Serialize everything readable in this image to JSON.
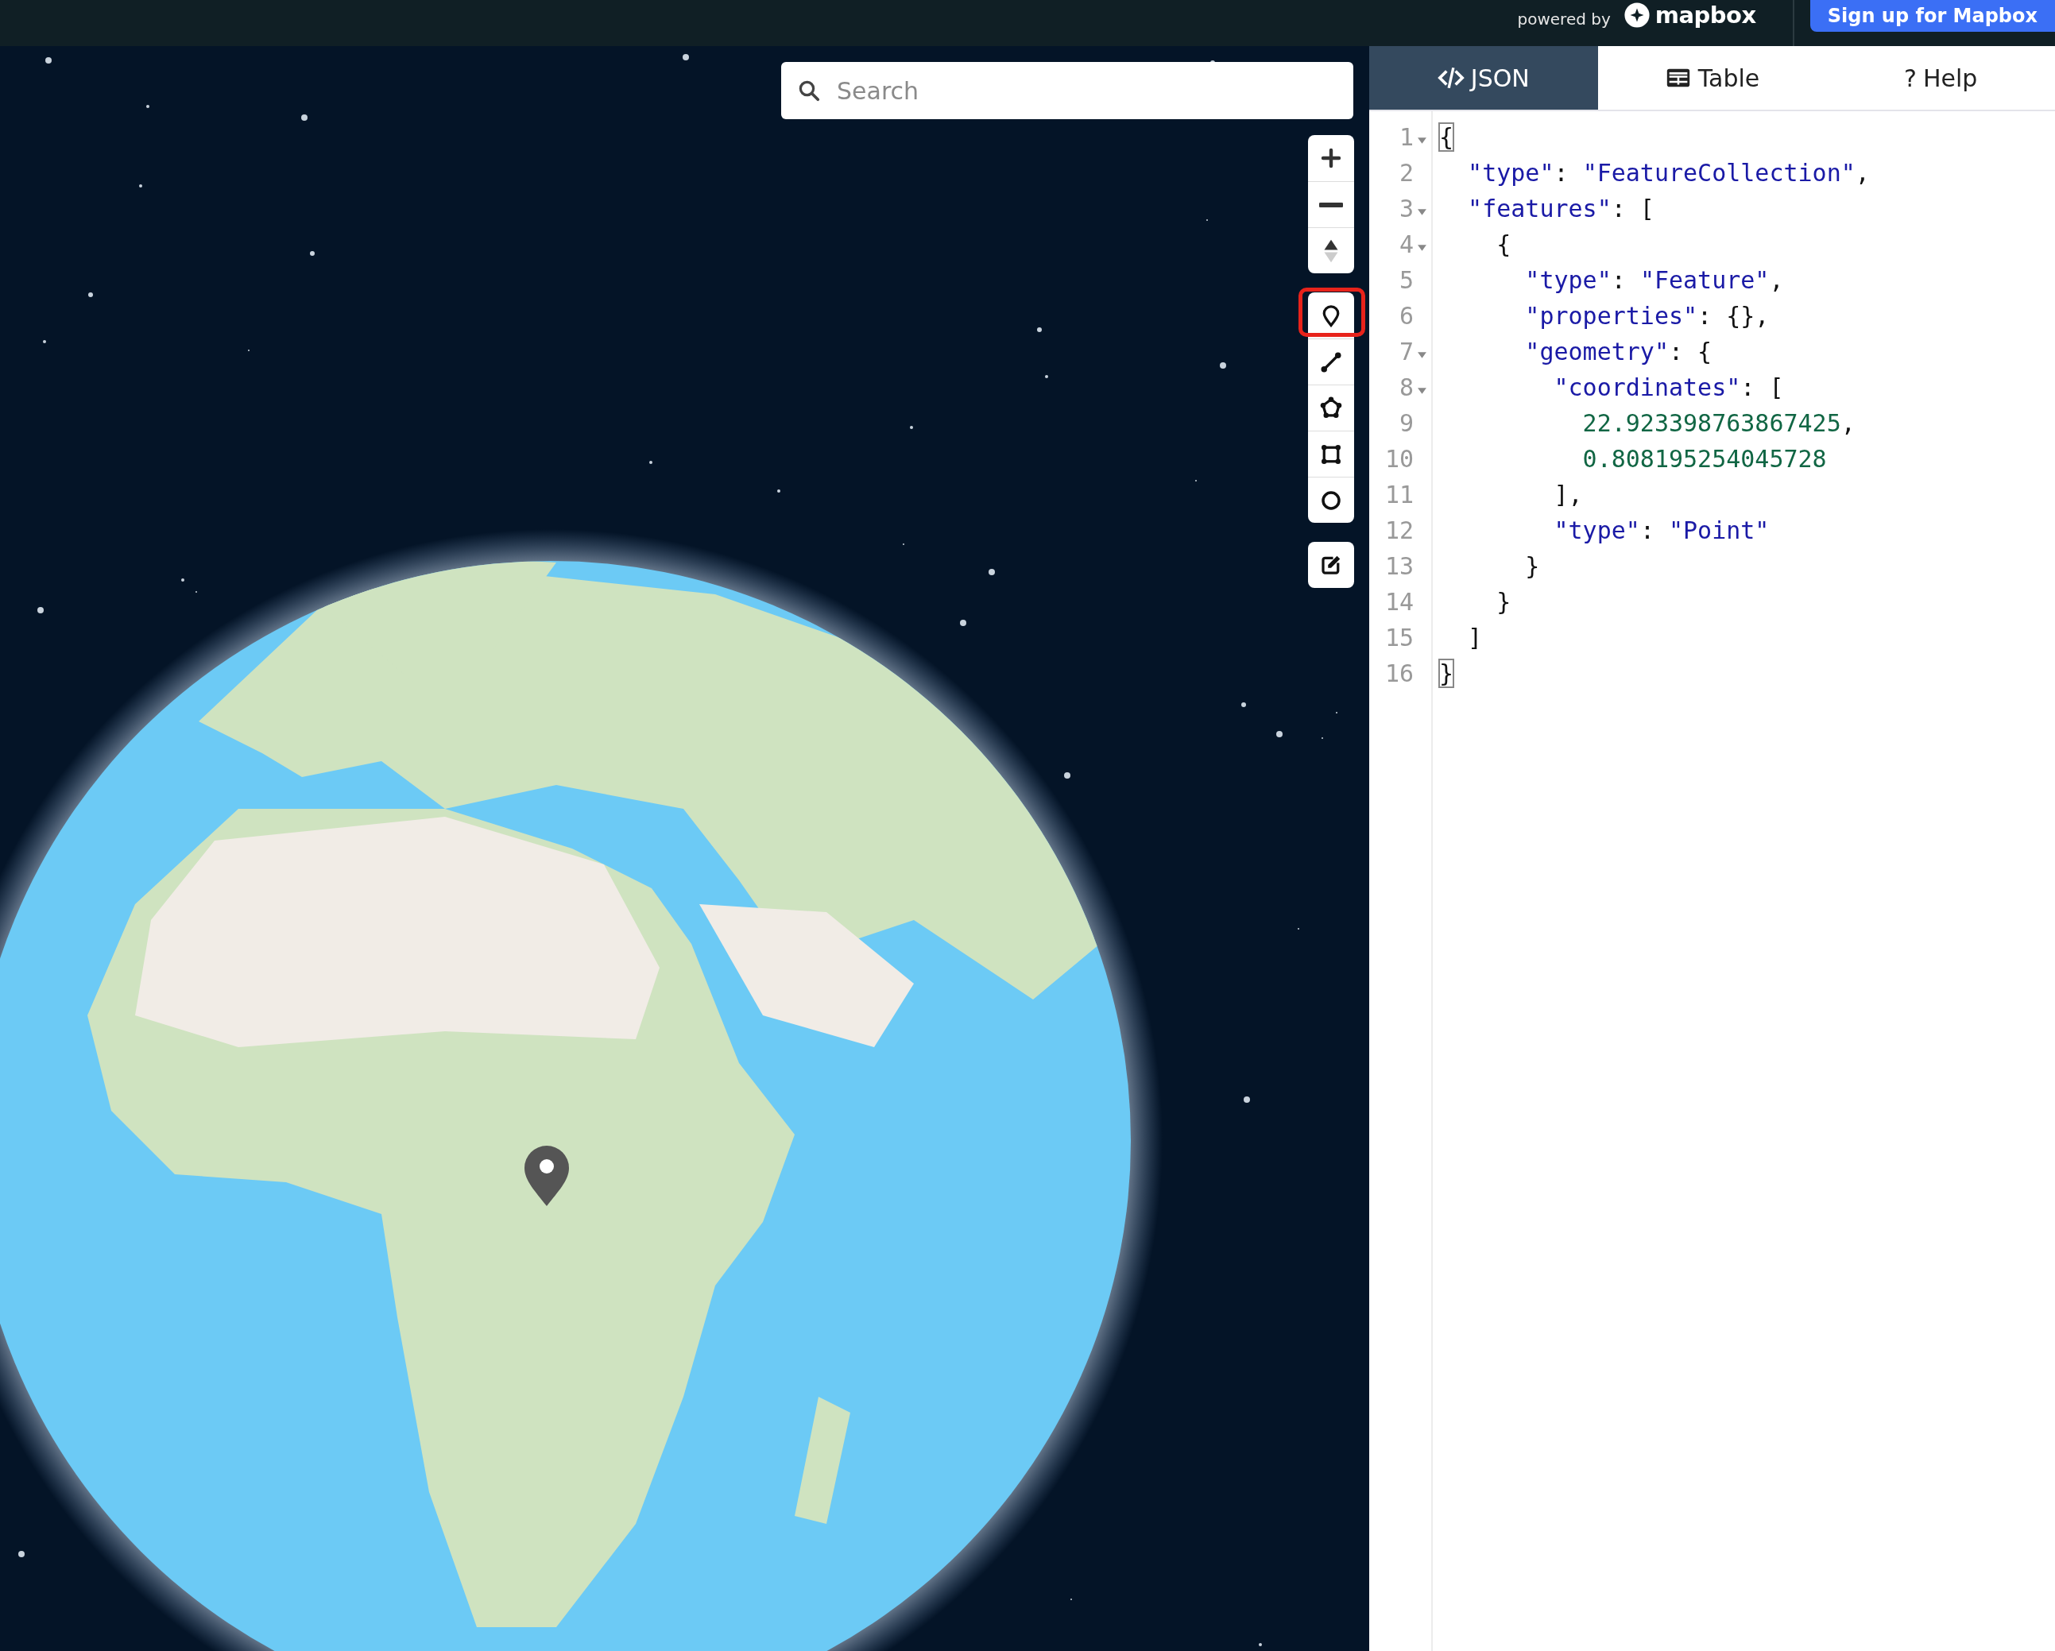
{
  "top_bar": {
    "powered_by": "powered by",
    "logo_text": "mapbox",
    "signup_button": "Sign up for Mapbox"
  },
  "map": {
    "search": {
      "placeholder": "Search"
    },
    "nav_controls": [
      {
        "kind": "zoom-in"
      },
      {
        "kind": "zoom-out"
      },
      {
        "kind": "compass"
      }
    ],
    "draw_tools": [
      {
        "kind": "point",
        "highlighted": true
      },
      {
        "kind": "line",
        "highlighted": false
      },
      {
        "kind": "polygon",
        "highlighted": false
      },
      {
        "kind": "rectangle",
        "highlighted": false
      },
      {
        "kind": "circle",
        "highlighted": false
      }
    ],
    "edit_tool": {
      "kind": "edit"
    }
  },
  "side_panel": {
    "tabs": [
      {
        "kind": "json",
        "label": "JSON",
        "selected": true
      },
      {
        "kind": "table",
        "label": "Table",
        "selected": false
      },
      {
        "kind": "help",
        "glyph": "?",
        "label": "Help",
        "selected": false
      }
    ],
    "code_lines": [
      {
        "number": "1",
        "foldable": true,
        "tokens": [
          {
            "kind": "punct",
            "text": "{",
            "matched": true
          }
        ]
      },
      {
        "number": "2",
        "foldable": false,
        "tokens": [
          {
            "kind": "key",
            "text": "  \"type\""
          },
          {
            "kind": "punct",
            "text": ": "
          },
          {
            "kind": "string",
            "text": "\"FeatureCollection\""
          },
          {
            "kind": "punct",
            "text": ","
          }
        ]
      },
      {
        "number": "3",
        "foldable": true,
        "tokens": [
          {
            "kind": "key",
            "text": "  \"features\""
          },
          {
            "kind": "punct",
            "text": ": ["
          }
        ]
      },
      {
        "number": "4",
        "foldable": true,
        "tokens": [
          {
            "kind": "punct",
            "text": "    {"
          }
        ]
      },
      {
        "number": "5",
        "foldable": false,
        "tokens": [
          {
            "kind": "key",
            "text": "      \"type\""
          },
          {
            "kind": "punct",
            "text": ": "
          },
          {
            "kind": "string",
            "text": "\"Feature\""
          },
          {
            "kind": "punct",
            "text": ","
          }
        ]
      },
      {
        "number": "6",
        "foldable": false,
        "tokens": [
          {
            "kind": "key",
            "text": "      \"properties\""
          },
          {
            "kind": "punct",
            "text": ": {},"
          }
        ]
      },
      {
        "number": "7",
        "foldable": true,
        "tokens": [
          {
            "kind": "key",
            "text": "      \"geometry\""
          },
          {
            "kind": "punct",
            "text": ": {"
          }
        ]
      },
      {
        "number": "8",
        "foldable": true,
        "tokens": [
          {
            "kind": "key",
            "text": "        \"coordinates\""
          },
          {
            "kind": "punct",
            "text": ": ["
          }
        ]
      },
      {
        "number": "9",
        "foldable": false,
        "tokens": [
          {
            "kind": "number",
            "text": "          22.923398763867425"
          },
          {
            "kind": "punct",
            "text": ","
          }
        ]
      },
      {
        "number": "10",
        "foldable": false,
        "tokens": [
          {
            "kind": "number",
            "text": "          0.808195254045728"
          }
        ]
      },
      {
        "number": "11",
        "foldable": false,
        "tokens": [
          {
            "kind": "punct",
            "text": "        ],"
          }
        ]
      },
      {
        "number": "12",
        "foldable": false,
        "tokens": [
          {
            "kind": "key",
            "text": "        \"type\""
          },
          {
            "kind": "punct",
            "text": ": "
          },
          {
            "kind": "string",
            "text": "\"Point\""
          }
        ]
      },
      {
        "number": "13",
        "foldable": false,
        "tokens": [
          {
            "kind": "punct",
            "text": "      }"
          }
        ]
      },
      {
        "number": "14",
        "foldable": false,
        "tokens": [
          {
            "kind": "punct",
            "text": "    }"
          }
        ]
      },
      {
        "number": "15",
        "foldable": false,
        "tokens": [
          {
            "kind": "punct",
            "text": "  ]"
          }
        ]
      },
      {
        "number": "16",
        "foldable": false,
        "tokens": [
          {
            "kind": "punct",
            "text": "}",
            "matched": true
          }
        ]
      }
    ]
  }
}
